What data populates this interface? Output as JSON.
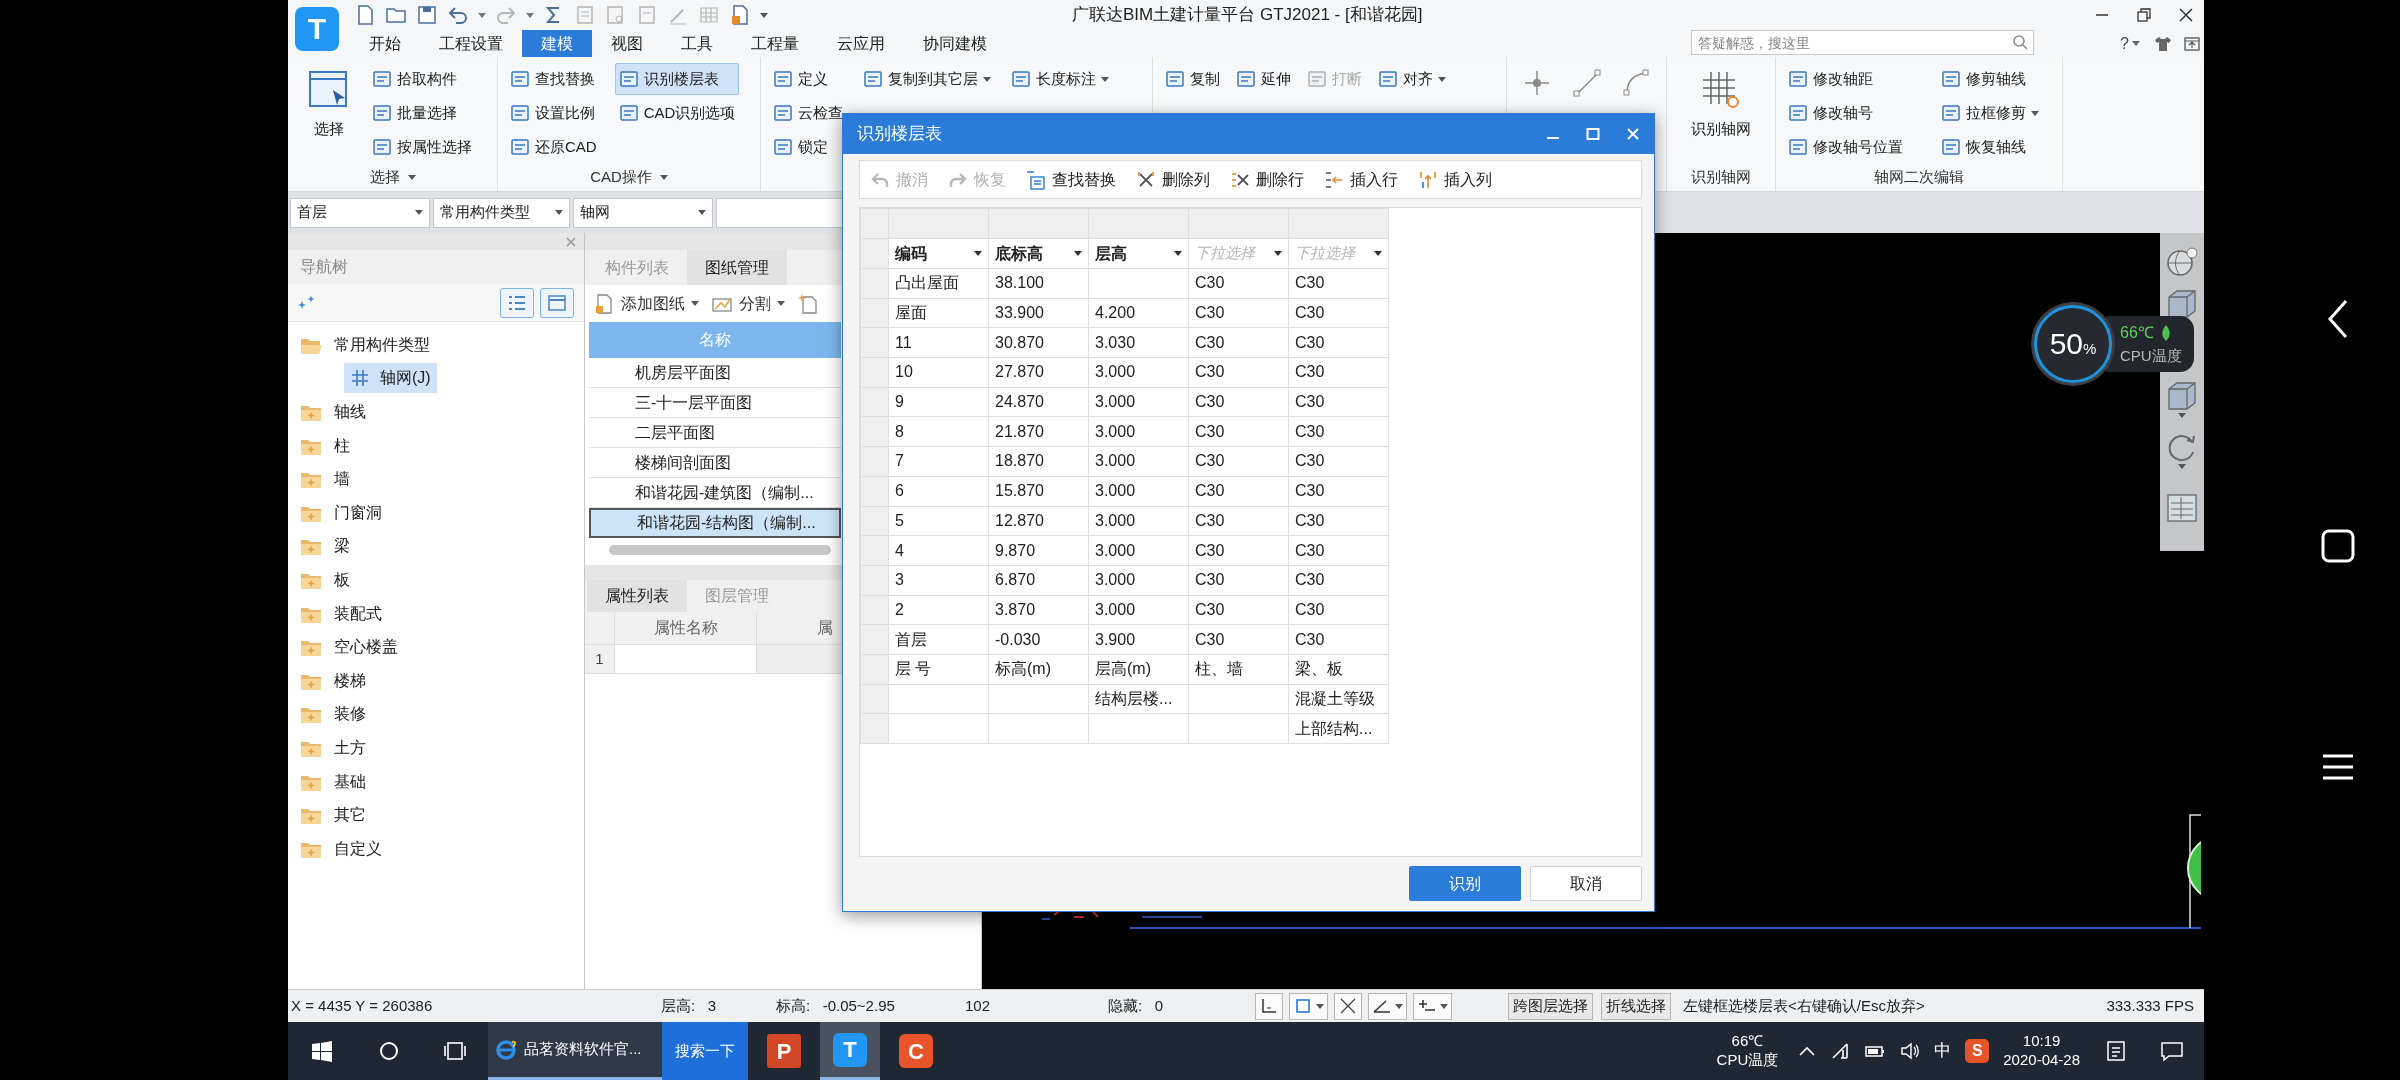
{
  "app_logo": "T",
  "title_bar": {
    "title": "广联达BIM土建计量平台 GTJ2021 - [和谐花园]",
    "search": {
      "placeholder": "答疑解惑，搜这里"
    },
    "help": "?"
  },
  "menu_tabs": [
    {
      "label": "开始",
      "selected": false
    },
    {
      "label": "工程设置",
      "selected": false
    },
    {
      "label": "建模",
      "selected": true
    },
    {
      "label": "视图",
      "selected": false
    },
    {
      "label": "工具",
      "selected": false
    },
    {
      "label": "工程量",
      "selected": false
    },
    {
      "label": "云应用",
      "selected": false
    },
    {
      "label": "协同建模",
      "selected": false
    }
  ],
  "ribbon": [
    {
      "label": "选择",
      "menu": true,
      "columns": [
        [
          {
            "kind": "large",
            "label": "选择",
            "disabled": false,
            "selected": false
          }
        ],
        [
          {
            "kind": "small",
            "label": "拾取构件",
            "disabled": false,
            "selected": false
          },
          {
            "kind": "small",
            "label": "批量选择",
            "disabled": false,
            "selected": false
          },
          {
            "kind": "small",
            "label": "按属性选择",
            "disabled": false,
            "selected": false
          }
        ]
      ]
    },
    {
      "label": "CAD操作",
      "menu": true,
      "columns": [
        [
          {
            "kind": "small",
            "label": "查找替换",
            "disabled": false,
            "selected": false
          },
          {
            "kind": "small",
            "label": "设置比例",
            "disabled": false,
            "selected": false
          },
          {
            "kind": "small",
            "label": "还原CAD",
            "disabled": false,
            "selected": false
          }
        ],
        [
          {
            "kind": "small",
            "label": "识别楼层表",
            "disabled": false,
            "selected": true
          },
          {
            "kind": "small",
            "label": "CAD识别选项",
            "disabled": false,
            "selected": false
          }
        ]
      ]
    },
    {
      "columns": [
        [
          {
            "kind": "small",
            "label": "定义",
            "disabled": false,
            "selected": false
          },
          {
            "kind": "small",
            "label": "云检查",
            "disabled": false,
            "selected": false
          },
          {
            "kind": "small",
            "label": "锁定",
            "disabled": false,
            "selected": false
          }
        ],
        [
          {
            "kind": "small",
            "label": "复制到其它层",
            "menu": true,
            "disabled": false,
            "selected": false
          }
        ],
        [
          {
            "kind": "small",
            "label": "长度标注",
            "menu": true,
            "disabled": false,
            "selected": false
          }
        ]
      ]
    },
    {
      "columns": [
        [
          {
            "kind": "small",
            "label": "复制",
            "disabled": false,
            "selected": false
          }
        ],
        [
          {
            "kind": "small",
            "label": "延伸",
            "disabled": false,
            "selected": false
          }
        ],
        [
          {
            "kind": "small",
            "label": "打断",
            "disabled": true,
            "selected": false
          }
        ],
        [
          {
            "kind": "small",
            "label": "对齐",
            "menu": true,
            "disabled": false,
            "selected": false
          }
        ]
      ]
    },
    {
      "columns": [
        [
          {
            "kind": "icon",
            "disabled": false,
            "selected": false
          }
        ],
        [
          {
            "kind": "icon",
            "disabled": false,
            "selected": false
          }
        ],
        [
          {
            "kind": "icon",
            "disabled": false,
            "selected": false
          }
        ]
      ]
    },
    {
      "label": "识别轴网",
      "columns": [
        [
          {
            "kind": "large",
            "label": "识别轴网",
            "disabled": false,
            "selected": false
          }
        ]
      ]
    },
    {
      "label": "轴网二次编辑",
      "columns": [
        [
          {
            "kind": "small",
            "label": "修改轴距",
            "disabled": false,
            "selected": false
          },
          {
            "kind": "small",
            "label": "修改轴号",
            "disabled": false,
            "selected": false
          },
          {
            "kind": "small",
            "label": "修改轴号位置",
            "disabled": false,
            "selected": false
          }
        ],
        [
          {
            "kind": "small",
            "label": "修剪轴线",
            "disabled": false,
            "selected": false
          },
          {
            "kind": "small",
            "label": "拉框修剪",
            "menu": true,
            "disabled": false,
            "selected": false
          },
          {
            "kind": "small",
            "label": "恢复轴线",
            "disabled": false,
            "selected": false
          }
        ]
      ]
    }
  ],
  "combos": [
    {
      "value": "首层"
    },
    {
      "value": "常用构件类型"
    },
    {
      "value": "轴网"
    }
  ],
  "nav_tree": {
    "title": "导航树",
    "items": [
      {
        "label": "常用构件类型",
        "expanded": true,
        "selected": false,
        "children": [
          {
            "label": "轴网(J)",
            "selected": true
          }
        ]
      },
      {
        "label": "轴线",
        "expanded": false,
        "selected": false
      },
      {
        "label": "柱",
        "expanded": false,
        "selected": false
      },
      {
        "label": "墙",
        "expanded": false,
        "selected": false
      },
      {
        "label": "门窗洞",
        "expanded": false,
        "selected": false
      },
      {
        "label": "梁",
        "expanded": false,
        "selected": false
      },
      {
        "label": "板",
        "expanded": false,
        "selected": false
      },
      {
        "label": "装配式",
        "expanded": false,
        "selected": false
      },
      {
        "label": "空心楼盖",
        "expanded": false,
        "selected": false
      },
      {
        "label": "楼梯",
        "expanded": false,
        "selected": false
      },
      {
        "label": "装修",
        "expanded": false,
        "selected": false
      },
      {
        "label": "土方",
        "expanded": false,
        "selected": false
      },
      {
        "label": "基础",
        "expanded": false,
        "selected": false
      },
      {
        "label": "其它",
        "expanded": false,
        "selected": false
      },
      {
        "label": "自定义",
        "expanded": false,
        "selected": false
      }
    ]
  },
  "drawing_panel": {
    "tabs": [
      {
        "label": "构件列表",
        "selected": false
      },
      {
        "label": "图纸管理",
        "selected": true
      }
    ],
    "toolbar": [
      {
        "label": "添加图纸",
        "menu": true
      },
      {
        "label": "分割",
        "menu": true
      }
    ],
    "column": "名称",
    "rows": [
      {
        "label": "机房层平面图",
        "selected": false
      },
      {
        "label": "三-十一层平面图",
        "selected": false
      },
      {
        "label": "二层平面图",
        "selected": false
      },
      {
        "label": "楼梯间剖面图",
        "selected": false
      },
      {
        "label": "和谐花园-建筑图（编制...",
        "selected": false
      },
      {
        "label": "和谐花园-结构图（编制...",
        "selected": true
      }
    ]
  },
  "properties_panel": {
    "tabs": [
      {
        "label": "属性列表",
        "selected": true
      },
      {
        "label": "图层管理",
        "selected": false
      }
    ],
    "columns": [
      "属性名称",
      "属"
    ],
    "rows": [
      "1"
    ]
  },
  "cpu_widget": {
    "value": "50",
    "unit": "%",
    "temperature": "66℃",
    "label": "CPU温度"
  },
  "dialog": {
    "title": "识别楼层表",
    "toolbar": [
      {
        "label": "撤消",
        "disabled": true
      },
      {
        "label": "恢复",
        "disabled": true
      },
      {
        "label": "查找替换",
        "disabled": false
      },
      {
        "label": "删除列",
        "disabled": false
      },
      {
        "label": "删除行",
        "disabled": false
      },
      {
        "label": "插入行",
        "disabled": false
      },
      {
        "label": "插入列",
        "disabled": false
      }
    ],
    "columns": [
      {
        "label": "编码"
      },
      {
        "label": "底标高"
      },
      {
        "label": "层高"
      },
      {
        "placeholder": "下拉选择"
      },
      {
        "placeholder": "下拉选择"
      }
    ],
    "rows": [
      [
        "凸出屋面",
        "38.100",
        null,
        "C30",
        "C30"
      ],
      [
        "屋面",
        "33.900",
        "4.200",
        "C30",
        "C30"
      ],
      [
        "11",
        "30.870",
        "3.030",
        "C30",
        "C30"
      ],
      [
        "10",
        "27.870",
        "3.000",
        "C30",
        "C30"
      ],
      [
        "9",
        "24.870",
        "3.000",
        "C30",
        "C30"
      ],
      [
        "8",
        "21.870",
        "3.000",
        "C30",
        "C30"
      ],
      [
        "7",
        "18.870",
        "3.000",
        "C30",
        "C30"
      ],
      [
        "6",
        "15.870",
        "3.000",
        "C30",
        "C30"
      ],
      [
        "5",
        "12.870",
        "3.000",
        "C30",
        "C30"
      ],
      [
        "4",
        "9.870",
        "3.000",
        "C30",
        "C30"
      ],
      [
        "3",
        "6.870",
        "3.000",
        "C30",
        "C30"
      ],
      [
        "2",
        "3.870",
        "3.000",
        "C30",
        "C30"
      ],
      [
        "首层",
        "-0.030",
        "3.900",
        "C30",
        "C30"
      ],
      [
        "层 号",
        "标高(m)",
        "层高(m)",
        "柱、墙",
        "梁、板"
      ],
      [
        null,
        null,
        "结构层楼...",
        null,
        "混凝土等级"
      ],
      [
        null,
        null,
        null,
        null,
        "上部结构..."
      ]
    ],
    "buttons": [
      {
        "label": "识别",
        "primary": true
      },
      {
        "label": "取消",
        "primary": false
      }
    ]
  },
  "status_bar": {
    "fields": [
      "X = 4435 Y = 260386",
      "层高:   3",
      "标高:   -0.05~2.95",
      "102",
      "隐藏:   0"
    ],
    "buttons": [
      "跨图层选择",
      "折线选择"
    ],
    "hint": "左键框选楼层表<右键确认/Esc放弃>",
    "fps": "333.333 FPS"
  },
  "taskbar": {
    "browser_task": "品茗资料软件官...",
    "search_button": "搜索一下",
    "apps": [
      {
        "logo": "P",
        "selected": false
      },
      {
        "logo": "T",
        "selected": true
      },
      {
        "logo": "C",
        "selected": false
      }
    ],
    "temperature": "66℃",
    "temperature_label": "CPU温度",
    "ime": "中",
    "tray_app": "S",
    "time": "10:19",
    "date": "2020-04-28"
  }
}
